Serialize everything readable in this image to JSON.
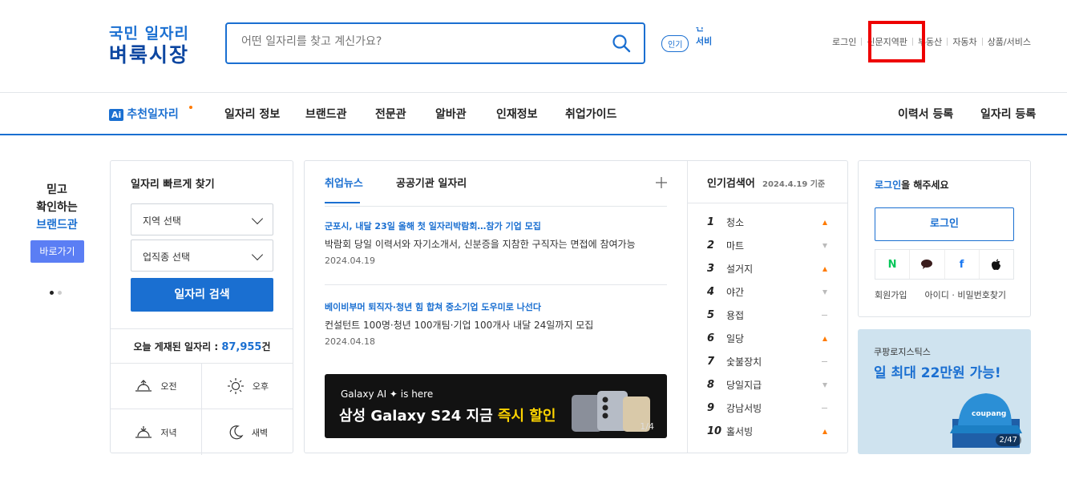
{
  "header": {
    "logo_top": "국민 일자리",
    "logo_main": "벼룩시장",
    "search_placeholder": "어떤 일자리를 찾고 계신가요?",
    "popular_badge": "인기",
    "popular_rolling": [
      "간",
      "서비"
    ],
    "top_links": [
      "로그인",
      "신문지역판",
      "부동산",
      "자동차",
      "상품/서비스"
    ]
  },
  "nav": {
    "ai_badge": "Ai",
    "items": [
      "추천일자리",
      "일자리 정보",
      "브랜드관",
      "전문관",
      "알바관",
      "인재정보",
      "취업가이드"
    ],
    "right_items": [
      "이력서 등록",
      "일자리 등록"
    ]
  },
  "side": {
    "line1": "믿고",
    "line2": "확인하는",
    "line3": "브랜드관",
    "go_button": "바로가기"
  },
  "quickfind": {
    "title": "일자리 빠르게 찾기",
    "region_select": "지역 선택",
    "job_select": "업직종 선택",
    "search_button": "일자리 검색",
    "today_label": "오늘 게재된 일자리 : ",
    "today_count": "87,955",
    "today_unit": "건",
    "times": [
      "오전",
      "오후",
      "저녁",
      "새벽"
    ]
  },
  "news": {
    "tabs": [
      "취업뉴스",
      "공공기관 일자리"
    ],
    "items": [
      {
        "title": "군포시, 내달 23일 올해 첫 일자리박람회…참가 기업 모집",
        "desc": "박람회 당일 이력서와 자기소개서, 신분증을 지참한 구직자는 면접에 참여가능",
        "date": "2024.04.19"
      },
      {
        "title": "베이비부머 퇴직자·청년 힘 합쳐 중소기업 도우미로 나선다",
        "desc": "컨설턴트 100명·청년 100개팀·기업 100개사 내달 24일까지 모집",
        "date": "2024.04.18"
      }
    ],
    "banner_line1": "Galaxy AI ✦ is here",
    "banner_line2a": "삼성 Galaxy S24 지금 ",
    "banner_line2b": "즉시 할인",
    "banner_page": "1/4"
  },
  "keywords": {
    "title": "인기검색어",
    "date": "2024.4.19 기준",
    "items": [
      {
        "rank": "1",
        "word": "청소",
        "trend": "up"
      },
      {
        "rank": "2",
        "word": "마트",
        "trend": "down"
      },
      {
        "rank": "3",
        "word": "설거지",
        "trend": "up"
      },
      {
        "rank": "4",
        "word": "야간",
        "trend": "down"
      },
      {
        "rank": "5",
        "word": "용접",
        "trend": "same"
      },
      {
        "rank": "6",
        "word": "일당",
        "trend": "up"
      },
      {
        "rank": "7",
        "word": "숯불장치",
        "trend": "same"
      },
      {
        "rank": "8",
        "word": "당일지급",
        "trend": "down"
      },
      {
        "rank": "9",
        "word": "강남서빙",
        "trend": "same"
      },
      {
        "rank": "10",
        "word": "홀서빙",
        "trend": "up"
      }
    ]
  },
  "login": {
    "msg_bold": "로그인",
    "msg_rest": "을 해주세요",
    "button": "로그인",
    "social": [
      "N",
      "●",
      "f",
      ""
    ],
    "links": [
      "회원가입",
      "아이디 · 비밀번호찾기"
    ]
  },
  "ad": {
    "line1": "쿠팡로지스틱스",
    "line2": "일 최대 22만원 가능!",
    "page": "2/47"
  },
  "colors": {
    "accent": "#1a6fd1",
    "highlight": "#ee0000",
    "trend_up": "#ff7a00"
  }
}
